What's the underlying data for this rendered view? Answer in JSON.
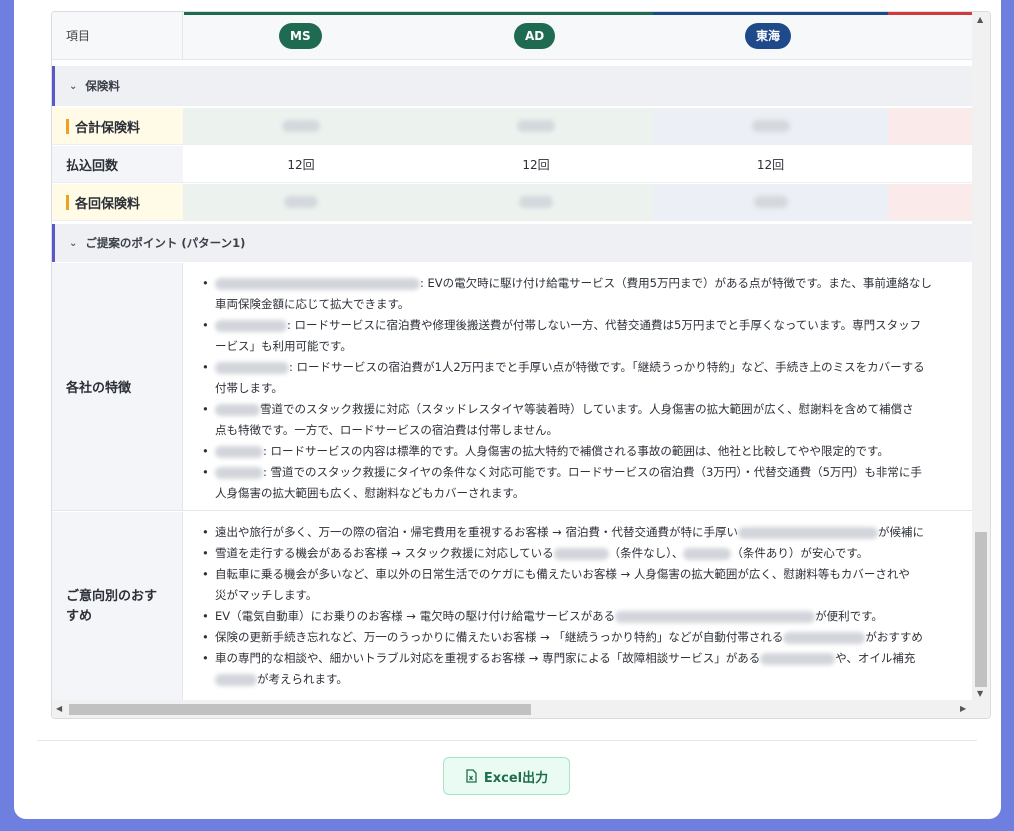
{
  "header": {
    "item_label": "項目",
    "companies": [
      {
        "name": "MS",
        "color": "#1f6b52"
      },
      {
        "name": "AD",
        "color": "#1f6b52"
      },
      {
        "name": "東海",
        "color": "#1e4a8a"
      }
    ]
  },
  "sections": {
    "premium_title": "保険料",
    "points_title": "ご提案のポイント (パターン1)"
  },
  "premium": {
    "total_label": "合計保険料",
    "count_label": "払込回数",
    "count_values": [
      "12回",
      "12回",
      "12回"
    ],
    "each_label": "各回保険料"
  },
  "features": {
    "label": "各社の特徴",
    "items": [
      {
        "text": ": EVの電欠時に駆け付け給電サービス（費用5万円まで）がある点が特徴です。また、事前連絡なし",
        "text2": "車両保険金額に応じて拡大できます。"
      },
      {
        "text": ": ロードサービスに宿泊費や修理後搬送費が付帯しない一方、代替交通費は5万円までと手厚くなっています。専門スタッフ",
        "text2": "ービス」も利用可能です。"
      },
      {
        "text": ": ロードサービスの宿泊費が1人2万円までと手厚い点が特徴です。「継続うっかり特約」など、手続き上のミスをカバーする",
        "text2": "付帯します。"
      },
      {
        "text": "雪道でのスタック救援に対応（スタッドレスタイヤ等装着時）しています。人身傷害の拡大範囲が広く、慰謝料を含めて補償さ",
        "text2": "点も特徴です。一方で、ロードサービスの宿泊費は付帯しません。"
      },
      {
        "text": ": ロードサービスの内容は標準的です。人身傷害の拡大特約で補償される事故の範囲は、他社と比較してやや限定的です。",
        "text2": ""
      },
      {
        "text": ": 雪道でのスタック救援にタイヤの条件なく対応可能です。ロードサービスの宿泊費（3万円）・代替交通費（5万円）も非常に手",
        "text2": "人身傷害の拡大範囲も広く、慰謝料などもカバーされます。"
      }
    ]
  },
  "recommend": {
    "label_line1": "ご意向別のおす",
    "label_line2": "すめ",
    "items": [
      {
        "pre": "遠出や旅行が多く、万一の際の宿泊・帰宅費用を重視するお客様 → 宿泊費・代替交通費が特に手厚い",
        "post": "が候補に"
      },
      {
        "pre": "雪道を走行する機会があるお客様 → スタック救援に対応している",
        "mid": "（条件なし）、",
        "post": "（条件あり）が安心です。"
      },
      {
        "pre": "自転車に乗る機会が多いなど、車以外の日常生活でのケガにも備えたいお客様 → 人身傷害の拡大範囲が広く、慰謝料等もカバーされや",
        "line2": "災がマッチします。"
      },
      {
        "pre": "EV（電気自動車）にお乗りのお客様 → 電欠時の駆け付け給電サービスがある",
        "post": "が便利です。"
      },
      {
        "pre": "保険の更新手続き忘れなど、万一のうっかりに備えたいお客様 → 「継続うっかり特約」などが自動付帯される",
        "post": "がおすすめ"
      },
      {
        "pre": "車の専門的な相談や、細かいトラブル対応を重視するお客様 → 専門家による「故障相談サービス」がある",
        "post": "や、オイル補充",
        "line2post": "が考えられます。"
      }
    ]
  },
  "footer": {
    "excel_label": "Excel出力"
  },
  "colors": {
    "accent": "#5b57c9",
    "green": "#1f6b52",
    "navy": "#1e4a8a",
    "red": "#d23b3b",
    "highlight": "#fffbe6"
  }
}
